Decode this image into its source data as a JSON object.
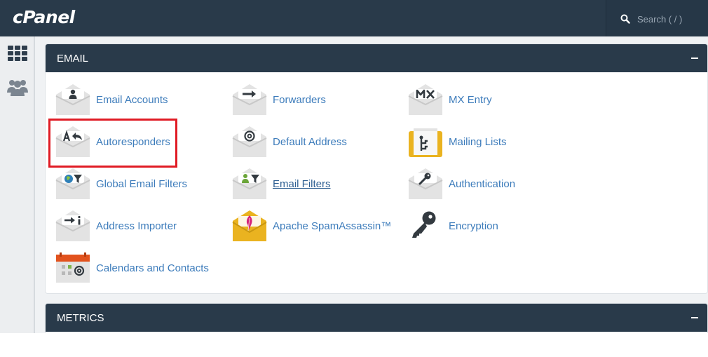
{
  "header": {
    "logo_text": "cPanel",
    "search": {
      "placeholder": "Search ( / )",
      "value": ""
    }
  },
  "sidebar": {
    "items": [
      {
        "name": "tools-grid",
        "icon": "grid-icon"
      },
      {
        "name": "users",
        "icon": "users-icon"
      }
    ]
  },
  "sections": {
    "email": {
      "title": "EMAIL",
      "items": [
        {
          "label": "Email Accounts",
          "icon": "email-accounts-icon"
        },
        {
          "label": "Forwarders",
          "icon": "forwarders-icon"
        },
        {
          "label": "MX Entry",
          "icon": "mx-entry-icon"
        },
        {
          "label": "Autoresponders",
          "icon": "autoresponders-icon",
          "highlighted": true
        },
        {
          "label": "Default Address",
          "icon": "default-address-icon"
        },
        {
          "label": "Mailing Lists",
          "icon": "mailing-lists-icon"
        },
        {
          "label": "Global Email Filters",
          "icon": "global-email-filters-icon"
        },
        {
          "label": "Email Filters",
          "icon": "email-filters-icon",
          "hovered": true
        },
        {
          "label": "Authentication",
          "icon": "authentication-icon"
        },
        {
          "label": "Address Importer",
          "icon": "address-importer-icon"
        },
        {
          "label": "Apache SpamAssassin™",
          "icon": "spamassassin-icon"
        },
        {
          "label": "Encryption",
          "icon": "encryption-key-icon"
        },
        {
          "label": "Calendars and Contacts",
          "icon": "calendars-contacts-icon"
        }
      ]
    },
    "metrics": {
      "title": "METRICS"
    }
  },
  "colors": {
    "header_bg": "#293a4a",
    "link": "#3d7cbb",
    "highlight": "#e01b24",
    "envelope": "#e3e3e3",
    "gold": "#eab320"
  }
}
